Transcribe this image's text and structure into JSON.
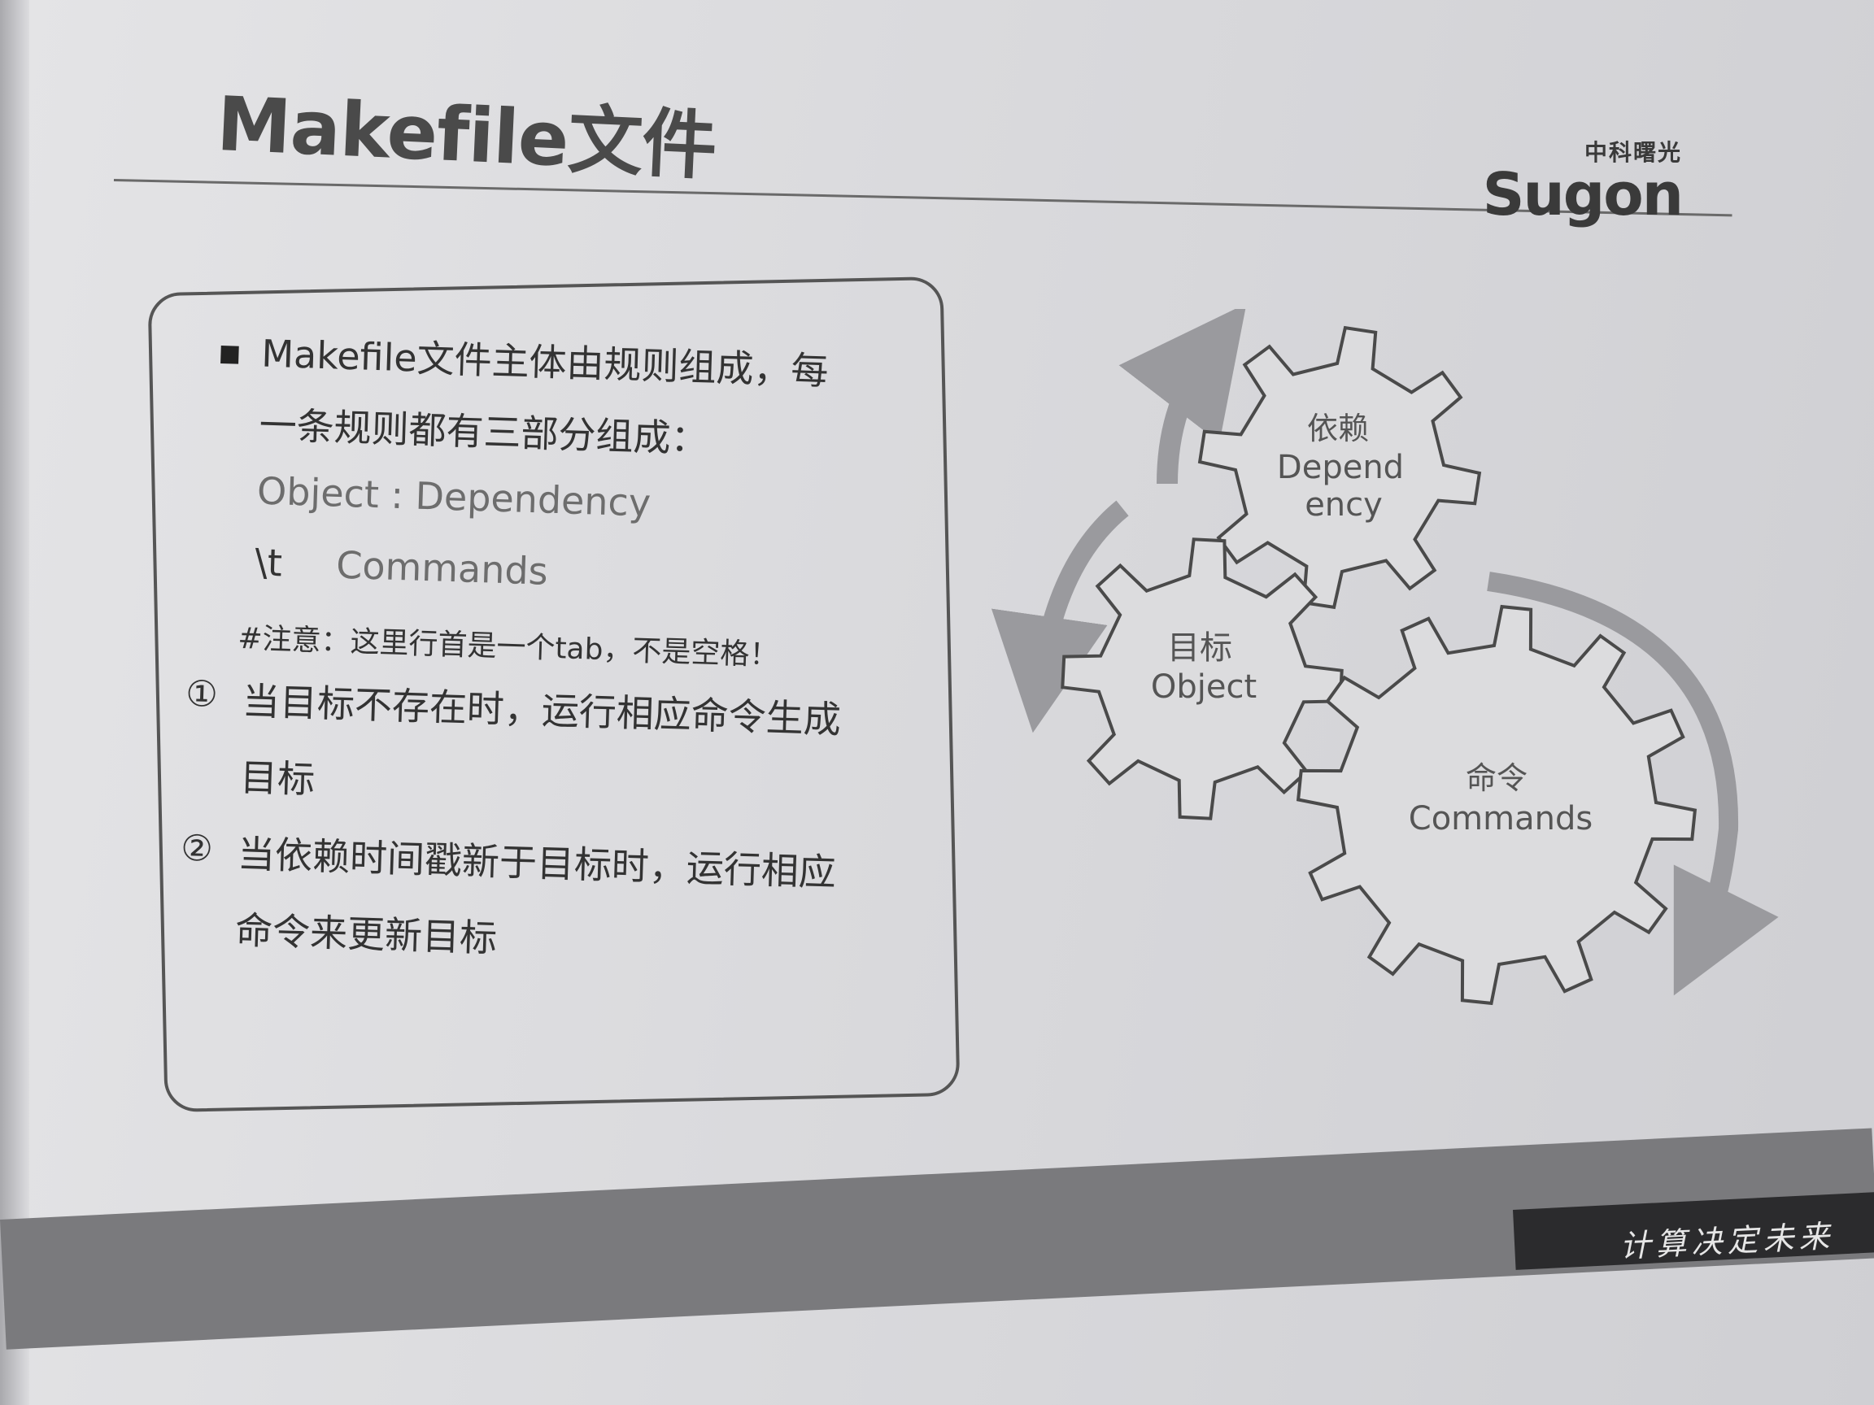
{
  "slide": {
    "title": "Makefile文件",
    "logo_cn": "中科曙光",
    "logo_en": "Sugon",
    "slogan": "计算决定未来"
  },
  "content": {
    "intro_line1": "Makefile文件主体由规则组成，每",
    "intro_line2": "一条规则都有三部分组成：",
    "syntax_line1": "Object : Dependency",
    "syntax_tab": "\\t",
    "syntax_commands": "Commands",
    "note": "#注意：这里行首是一个tab，不是空格！",
    "item1_marker": "①",
    "item1_line1": "当目标不存在时，运行相应命令生成",
    "item1_line2": "目标",
    "item2_marker": "②",
    "item2_line1": "当依赖时间戳新于目标时，运行相应",
    "item2_line2": "命令来更新目标"
  },
  "diagram": {
    "dependency_cn": "依赖",
    "dependency_en_1": "Depend",
    "dependency_en_2": "ency",
    "object_cn": "目标",
    "object_en": "Object",
    "commands_cn": "命令",
    "commands_en": "Commands"
  },
  "colors": {
    "gear_fill": "#dcdcde",
    "gear_stroke": "#4a4a4a",
    "arrow": "#9a9a9e",
    "footer": "#7a7a7d"
  }
}
